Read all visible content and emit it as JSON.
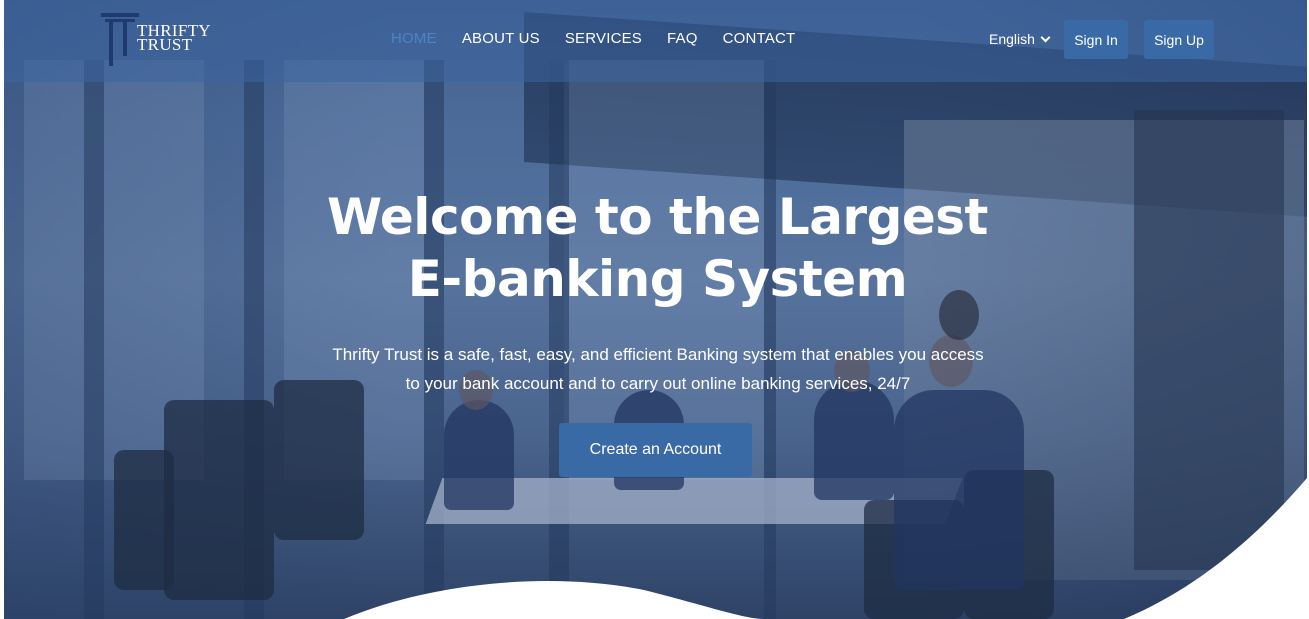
{
  "brand": {
    "line1": "THRIFTY",
    "line2": "TRUST"
  },
  "nav": {
    "links": [
      {
        "label": "HOME",
        "active": true
      },
      {
        "label": "ABOUT US",
        "active": false
      },
      {
        "label": "SERVICES",
        "active": false
      },
      {
        "label": "FAQ",
        "active": false
      },
      {
        "label": "CONTACT",
        "active": false
      }
    ],
    "language": "English",
    "sign_in": "Sign In",
    "sign_up": "Sign Up"
  },
  "hero": {
    "title": "Welcome to the Largest E-banking System",
    "subtitle": "Thrifty Trust is a safe, fast, easy, and efficient Banking system that enables you access to your bank account and to carry out online banking services, 24/7",
    "cta": "Create an Account"
  },
  "colors": {
    "accent": "#3a6aa6",
    "active_link": "#4f82c2",
    "text": "#ffffff"
  },
  "icons": [
    "logo-icon",
    "chevron-down-icon"
  ]
}
